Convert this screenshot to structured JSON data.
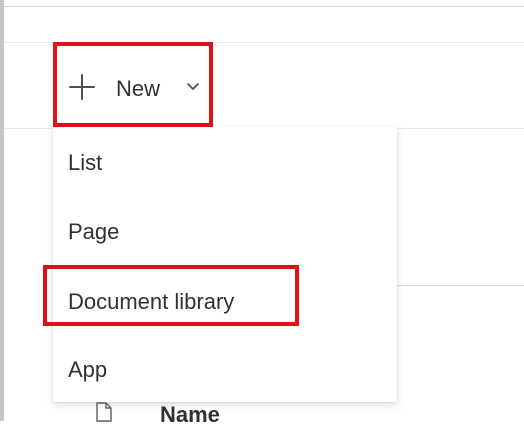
{
  "toolbar": {
    "new_label": "New",
    "plus_icon": "plus-icon",
    "chevron_icon": "chevron-down-icon"
  },
  "menu": {
    "items": [
      {
        "label": "List"
      },
      {
        "label": "Page"
      },
      {
        "label": "Document library"
      },
      {
        "label": "App"
      }
    ]
  },
  "library": {
    "column_header": "Name",
    "file_icon": "document-icon"
  },
  "colors": {
    "highlight": "#e10f16",
    "text": "#323130",
    "divider": "#edebe9"
  }
}
